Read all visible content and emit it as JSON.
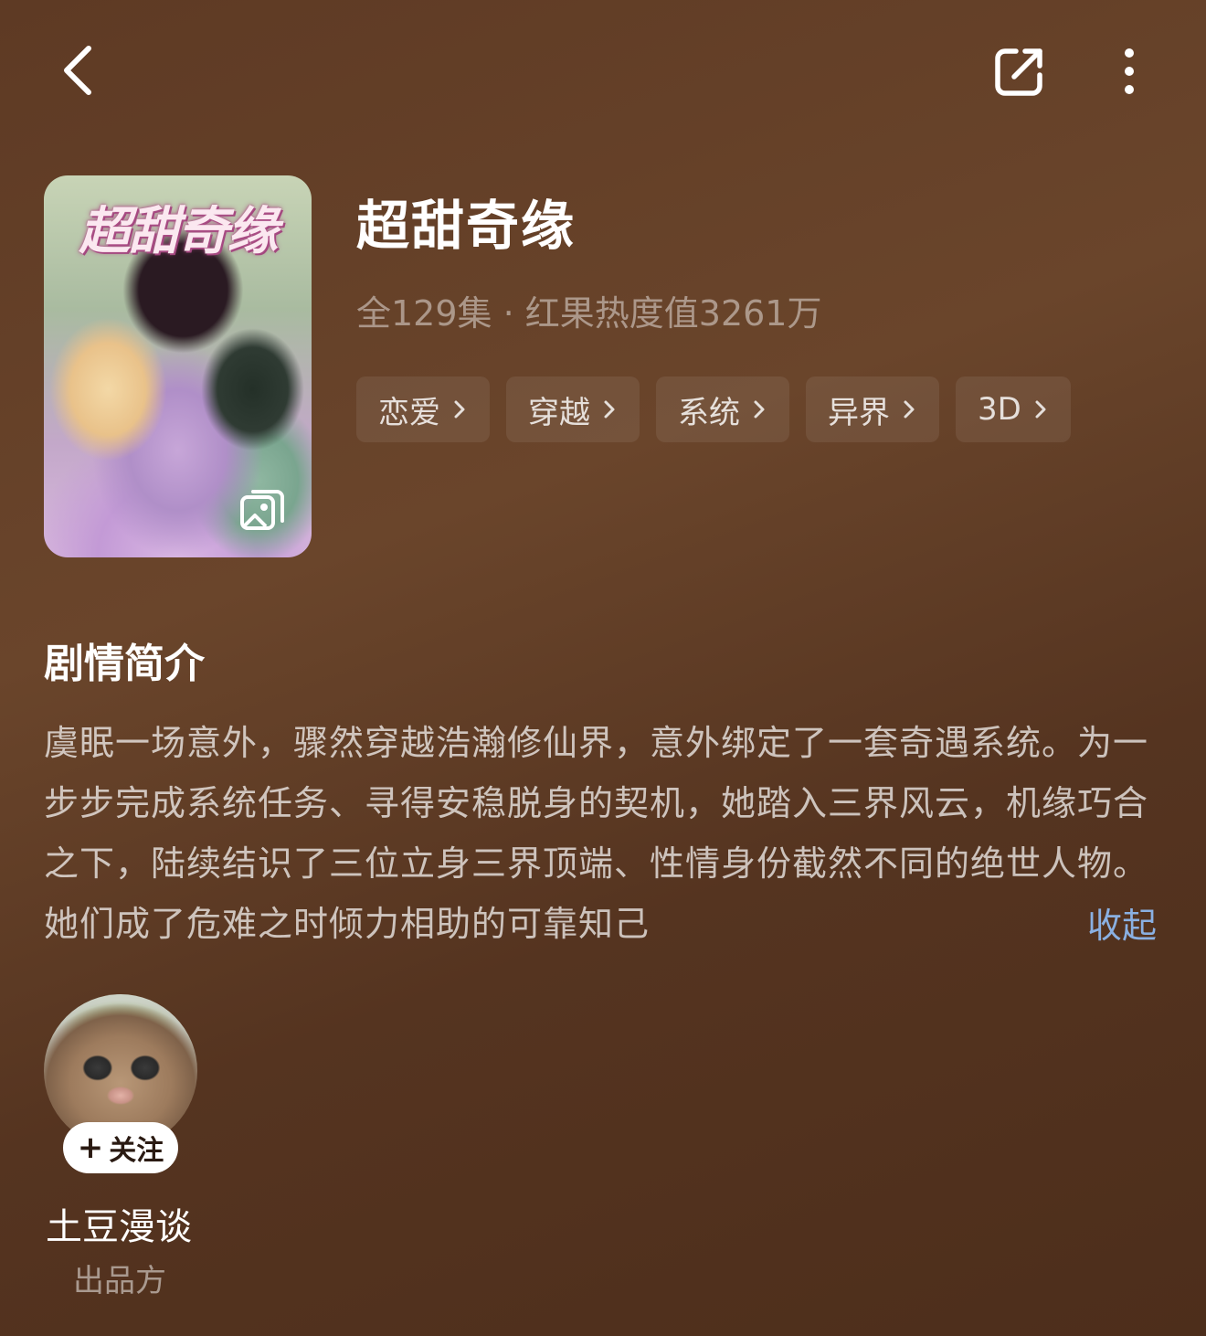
{
  "header": {
    "back_icon": "chevron-left-icon",
    "share_icon": "share-external-icon",
    "more_icon": "more-vertical-icon"
  },
  "drama": {
    "cover_title": "超甜奇缘",
    "title": "超甜奇缘",
    "meta": "全129集 · 红果热度值3261万",
    "tags": [
      "恋爱",
      "穿越",
      "系统",
      "异界",
      "3D"
    ]
  },
  "synopsis": {
    "heading": "剧情简介",
    "text": "虞眠一场意外，骤然穿越浩瀚修仙界，意外绑定了一套奇遇系统。为一步步完成系统任务、寻得安稳脱身的契机，她踏入三界风云，机缘巧合之下，陆续结识了三位立身三界顶端、性情身份截然不同的绝世人物。她们成了危难之时倾力相助的可靠知己",
    "collapse_label": "收起"
  },
  "producer": {
    "follow_label": "关注",
    "name": "土豆漫谈",
    "role": "出品方"
  }
}
